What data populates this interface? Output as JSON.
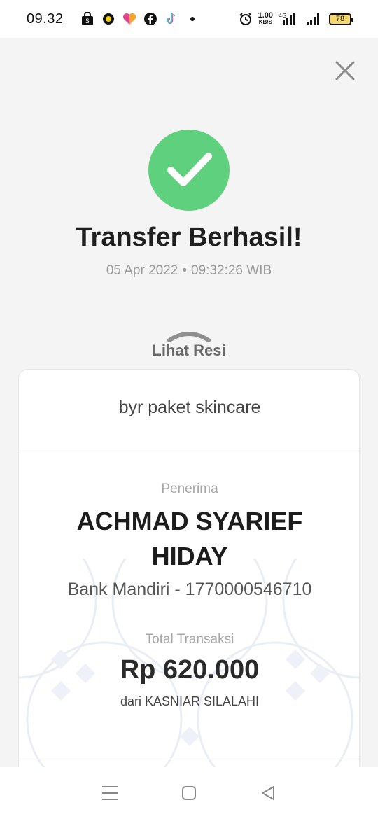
{
  "status_bar": {
    "time": "09.32",
    "net_speed": "1.00",
    "net_unit": "KB/S",
    "network_type": "4G",
    "battery": "78",
    "icons": [
      "shopping-bag-icon",
      "circle-app-icon",
      "heart-icon",
      "facebook-icon",
      "tiktok-icon",
      "dot-icon",
      "alarm-icon",
      "signal-icon",
      "signal-icon",
      "battery-icon"
    ]
  },
  "header": {
    "title": "Transfer Berhasil!",
    "date": "05 Apr 2022",
    "separator": "•",
    "time": "09:32:26 WIB"
  },
  "resi": {
    "label": "Lihat Resi"
  },
  "card": {
    "note": "byr paket skincare",
    "recipient_label": "Penerima",
    "recipient_name": "ACHMAD SYARIEF HIDAY",
    "bank_info": "Bank Mandiri - 1770000546710",
    "total_label": "Total Transaksi",
    "total_amount": "Rp 620.000",
    "sender": "dari KASNIAR SILALAHI"
  },
  "colors": {
    "success": "#5fd07e",
    "background": "#f4f4f4"
  }
}
